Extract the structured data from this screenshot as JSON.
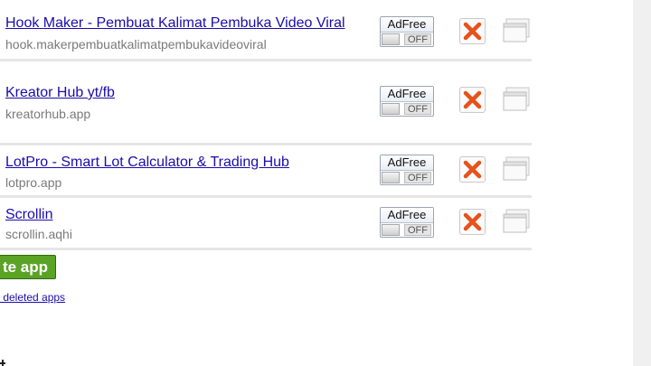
{
  "apps": [
    {
      "name": "Hook Maker - Pembuat Kalimat Pembuka Video Viral",
      "host": "hook.makerpembuatkalimatpembukavideoviral",
      "adfree_label": "AdFree",
      "adfree_state": "OFF"
    },
    {
      "name": "Kreator Hub yt/fb",
      "host": "kreatorhub.app",
      "adfree_label": "AdFree",
      "adfree_state": "OFF"
    },
    {
      "name": "LotPro - Smart Lot Calculator & Trading Hub",
      "host": "lotpro.app",
      "adfree_label": "AdFree",
      "adfree_state": "OFF"
    },
    {
      "name": "Scrollin",
      "host": "scrollin.aqhi",
      "adfree_label": "AdFree",
      "adfree_state": "OFF"
    }
  ],
  "actions": {
    "create_label": "te app",
    "deleted_link": "r deleted apps"
  },
  "icons": {
    "delete": "x-icon",
    "window": "window-icon"
  },
  "colors": {
    "link": "#1a0dab",
    "create_button": "#5aa324",
    "delete_x": "#e8511a"
  }
}
